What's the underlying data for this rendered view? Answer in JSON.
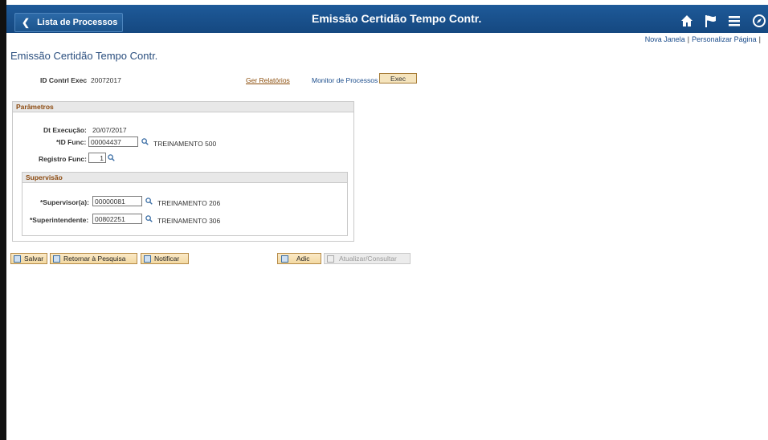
{
  "header": {
    "back_label": "Lista de Processos",
    "title": "Emissão Certidão Tempo Contr.",
    "icons": [
      "home-icon",
      "flag-icon",
      "menu-icon",
      "compass-icon"
    ]
  },
  "links": {
    "new_window": "Nova Janela",
    "separator": "|",
    "personalize": "Personalizar Página",
    "trailing_separator": "|"
  },
  "page": {
    "title": "Emissão Certidão Tempo Contr.",
    "run_id_label": "ID Contrl Exec",
    "run_id_value": "20072017",
    "report_link": "Ger Relatórios",
    "process_monitor_link": "Monitor de Processos",
    "exec_button": "Exec"
  },
  "parametros": {
    "heading": "Parâmetros",
    "exec_date_label": "Dt Execução:",
    "exec_date_value": "20/07/2017",
    "func_id_label": "*ID Func:",
    "func_id_value": "00004437",
    "func_name": "TREINAMENTO 500",
    "registro_label": "Registro Func:",
    "registro_value": "1"
  },
  "supervisao": {
    "heading": "Supervisão",
    "supervisor_label": "*Supervisor(a):",
    "supervisor_value": "00000081",
    "supervisor_name": "TREINAMENTO 206",
    "superintendente_label": "*Superintendente:",
    "superintendente_value": "00802251",
    "superintendente_name": "TREINAMENTO 306"
  },
  "toolbar": {
    "save_label": "Salvar",
    "return_label": "Retornar à Pesquisa",
    "notify_label": "Notificar",
    "add_label": "Adic",
    "update_label": "Atualizar/Consultar"
  }
}
